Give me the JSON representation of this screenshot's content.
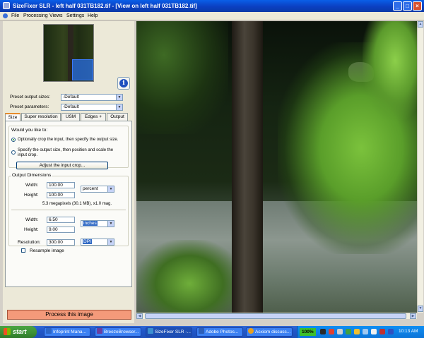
{
  "window": {
    "title": "SizeFixer SLR - left half 031TB182.tif - [View on left half 031TB182.tif]",
    "minimize": "_",
    "maximize": "□",
    "close": "×"
  },
  "menu": {
    "items": [
      "File",
      "Processing",
      "Views",
      "Settings",
      "Help"
    ]
  },
  "panel": {
    "info_glyph": "i",
    "preset_output_label": "Preset output sizes:",
    "preset_output_value": "-Default",
    "preset_params_label": "Preset parameters:",
    "preset_params_value": "-Default",
    "tabs": [
      "Size",
      "Super resolution",
      "USM",
      "Edges +",
      "Output"
    ],
    "size_tab": {
      "question": "Would you like to:",
      "option1": "Optionally crop the input, then specify the output size.",
      "option2_line1": "Specify the output size, then position and scale the",
      "option2_line2": "input crop.",
      "adjust_button": "Adjust the input crop...",
      "output_dims_label": "Output Dimensions",
      "width_label": "Width:",
      "width_value": "100.00",
      "height_label": "Height:",
      "height_value": "100.00",
      "percent_unit": "percent",
      "megapixels_text": "5.3 megapixels (30.1 MB), x1.0 mag.",
      "width2_label": "Width:",
      "width2_value": "6.50",
      "height2_label": "Height:",
      "height2_value": "9.00",
      "inches_unit": "inches",
      "resolution_label": "Resolution:",
      "resolution_value": "300.00",
      "resolution_unit": "DPI",
      "resample_label": "Resample image"
    },
    "process_button": "Process this image"
  },
  "taskbar": {
    "start": "start",
    "tasks": [
      {
        "label": "Infoprint Mana...",
        "color": "#2c66c8"
      },
      {
        "label": "BreezeBrowser...",
        "color": "#6a3fa0"
      },
      {
        "label": "SizeFixer SLR -...",
        "color": "#3c8fd0"
      },
      {
        "label": "Adobe Photos...",
        "color": "#2d5fb8"
      },
      {
        "label": "Acxiom discuss...",
        "color": "#e8a020"
      }
    ],
    "battery": "100%",
    "clock": "10:13 AM"
  }
}
